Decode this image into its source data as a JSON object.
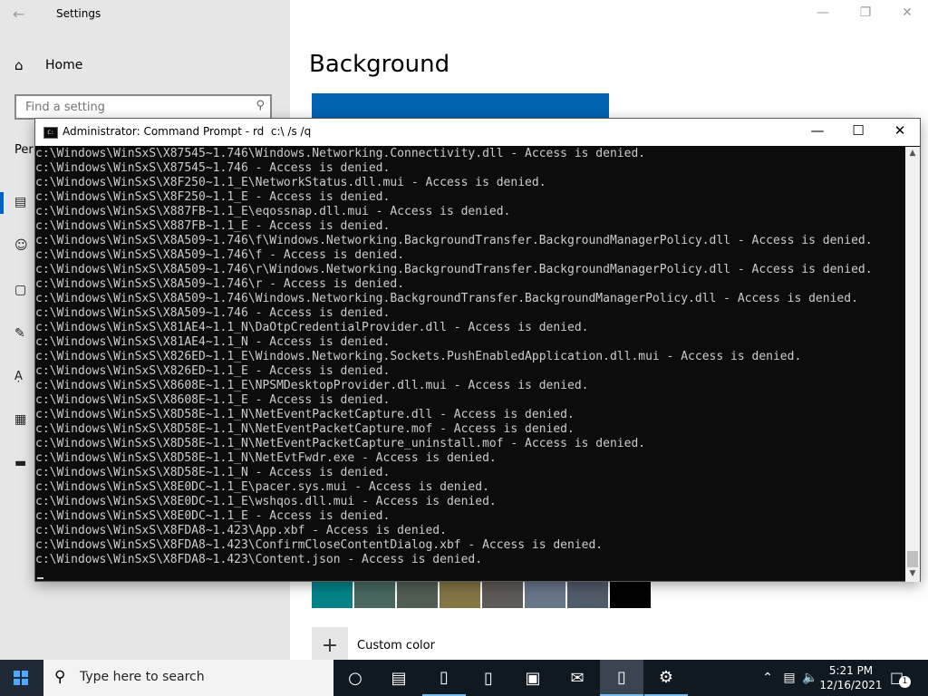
{
  "settings": {
    "title": "Settings",
    "home_label": "Home",
    "search_placeholder": "Find a setting",
    "section_partial": "Per",
    "page_title": "Background",
    "custom_color_label": "Custom color",
    "swatch_colors": [
      "#038387",
      "#486860",
      "#525e54",
      "#847545",
      "#5d5a58",
      "#68768a",
      "#515c6b",
      "#000000"
    ]
  },
  "cmd": {
    "title": "Administrator: Command Prompt - rd  c:\\ /s /q",
    "lines": [
      "c:\\Windows\\WinSxS\\X87545~1.746\\Windows.Networking.Connectivity.dll - Access is denied.",
      "c:\\Windows\\WinSxS\\X87545~1.746 - Access is denied.",
      "c:\\Windows\\WinSxS\\X8F250~1.1_E\\NetworkStatus.dll.mui - Access is denied.",
      "c:\\Windows\\WinSxS\\X8F250~1.1_E - Access is denied.",
      "c:\\Windows\\WinSxS\\X887FB~1.1_E\\eqossnap.dll.mui - Access is denied.",
      "c:\\Windows\\WinSxS\\X887FB~1.1_E - Access is denied.",
      "c:\\Windows\\WinSxS\\X8A509~1.746\\f\\Windows.Networking.BackgroundTransfer.BackgroundManagerPolicy.dll - Access is denied.",
      "c:\\Windows\\WinSxS\\X8A509~1.746\\f - Access is denied.",
      "c:\\Windows\\WinSxS\\X8A509~1.746\\r\\Windows.Networking.BackgroundTransfer.BackgroundManagerPolicy.dll - Access is denied.",
      "c:\\Windows\\WinSxS\\X8A509~1.746\\r - Access is denied.",
      "c:\\Windows\\WinSxS\\X8A509~1.746\\Windows.Networking.BackgroundTransfer.BackgroundManagerPolicy.dll - Access is denied.",
      "c:\\Windows\\WinSxS\\X8A509~1.746 - Access is denied.",
      "c:\\Windows\\WinSxS\\X81AE4~1.1_N\\DaOtpCredentialProvider.dll - Access is denied.",
      "c:\\Windows\\WinSxS\\X81AE4~1.1_N - Access is denied.",
      "c:\\Windows\\WinSxS\\X826ED~1.1_E\\Windows.Networking.Sockets.PushEnabledApplication.dll.mui - Access is denied.",
      "c:\\Windows\\WinSxS\\X826ED~1.1_E - Access is denied.",
      "c:\\Windows\\WinSxS\\X8608E~1.1_E\\NPSMDesktopProvider.dll.mui - Access is denied.",
      "c:\\Windows\\WinSxS\\X8608E~1.1_E - Access is denied.",
      "c:\\Windows\\WinSxS\\X8D58E~1.1_N\\NetEventPacketCapture.dll - Access is denied.",
      "c:\\Windows\\WinSxS\\X8D58E~1.1_N\\NetEventPacketCapture.mof - Access is denied.",
      "c:\\Windows\\WinSxS\\X8D58E~1.1_N\\NetEventPacketCapture_uninstall.mof - Access is denied.",
      "c:\\Windows\\WinSxS\\X8D58E~1.1_N\\NetEvtFwdr.exe - Access is denied.",
      "c:\\Windows\\WinSxS\\X8D58E~1.1_N - Access is denied.",
      "c:\\Windows\\WinSxS\\X8E0DC~1.1_E\\pacer.sys.mui - Access is denied.",
      "c:\\Windows\\WinSxS\\X8E0DC~1.1_E\\wshqos.dll.mui - Access is denied.",
      "c:\\Windows\\WinSxS\\X8E0DC~1.1_E - Access is denied.",
      "c:\\Windows\\WinSxS\\X8FDA8~1.423\\App.xbf - Access is denied.",
      "c:\\Windows\\WinSxS\\X8FDA8~1.423\\ConfirmCloseContentDialog.xbf - Access is denied.",
      "c:\\Windows\\WinSxS\\X8FDA8~1.423\\Content.json - Access is denied."
    ]
  },
  "taskbar": {
    "search_placeholder": "Type here to search",
    "time": "5:21 PM",
    "date": "12/16/2021",
    "notification_count": "1"
  }
}
